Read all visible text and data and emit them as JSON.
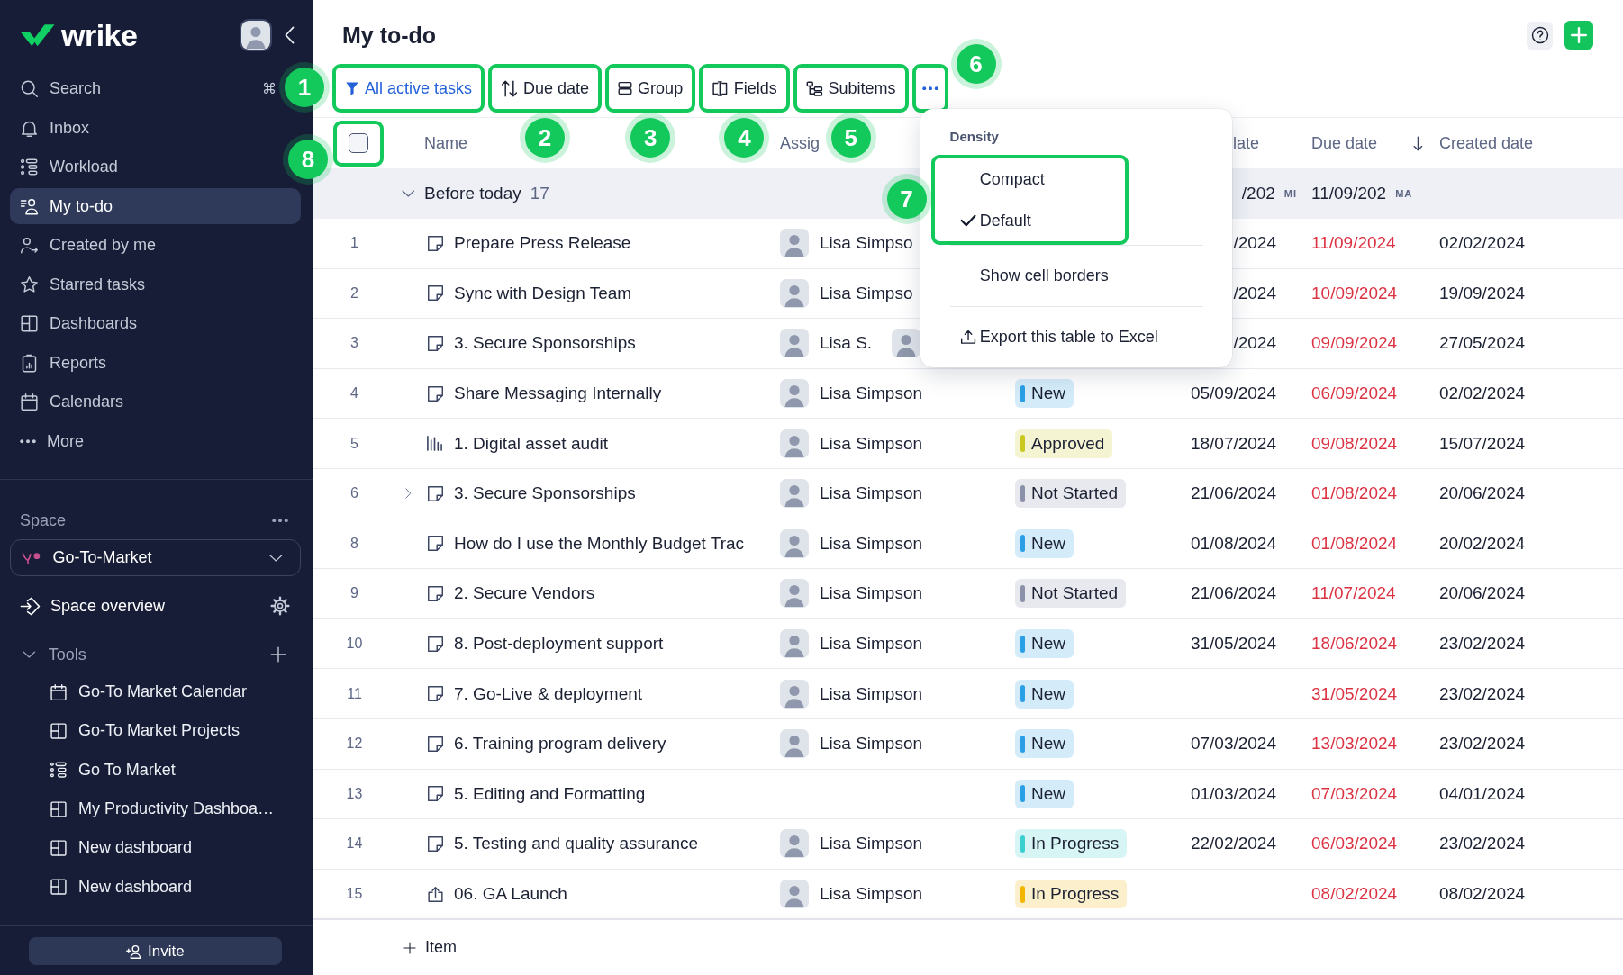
{
  "sidebar": {
    "logo": "wrike",
    "nav": [
      {
        "label": "Search",
        "shortcut": "⌘",
        "selected": false
      },
      {
        "label": "Inbox",
        "selected": false
      },
      {
        "label": "Workload",
        "selected": false
      },
      {
        "label": "My to-do",
        "selected": true
      },
      {
        "label": "Created by me",
        "selected": false
      },
      {
        "label": "Starred tasks",
        "selected": false
      },
      {
        "label": "Dashboards",
        "selected": false
      },
      {
        "label": "Reports",
        "selected": false
      },
      {
        "label": "Calendars",
        "selected": false
      },
      {
        "label": "More",
        "selected": false
      }
    ],
    "space": {
      "heading": "Space",
      "current": "Go-To-Market",
      "overview": "Space overview",
      "tools_label": "Tools",
      "tools_expanded": true,
      "tools": [
        {
          "label": "Go-To Market Calendar"
        },
        {
          "label": "Go-To Market Projects"
        },
        {
          "label": "Go To Market"
        },
        {
          "label": "My Productivity Dashboa…"
        },
        {
          "label": "New dashboard"
        },
        {
          "label": "New dashboard"
        }
      ]
    },
    "invite": "Invite"
  },
  "main": {
    "title": "My to-do",
    "toolbar": [
      {
        "label": "All active tasks",
        "active": true,
        "highlighted": true,
        "callout": "1"
      },
      {
        "label": "Due date",
        "active": false,
        "highlighted": true,
        "callout": "2"
      },
      {
        "label": "Group",
        "active": false,
        "highlighted": true,
        "callout": "3"
      },
      {
        "label": "Fields",
        "active": false,
        "highlighted": true,
        "callout": "4"
      },
      {
        "label": "Subitems",
        "active": false,
        "highlighted": true,
        "callout": "5"
      }
    ],
    "more": {
      "highlighted": true,
      "open": true,
      "callout": "6"
    },
    "menu": {
      "heading": "Density",
      "options_highlighted": true,
      "options_callout": "7",
      "options": [
        {
          "label": "Compact",
          "selected": false
        },
        {
          "label": "Default",
          "selected": true
        }
      ],
      "items": [
        {
          "kind": "toggle",
          "label": "Show cell borders",
          "checked": false
        },
        {
          "kind": "action",
          "label": "Export this table to Excel"
        }
      ]
    }
  },
  "table": {
    "select_all": {
      "checked": false,
      "highlighted": true,
      "callout": "8"
    },
    "columns": [
      {
        "kind": "name",
        "label": "Name",
        "sorted": false
      },
      {
        "kind": "assignee",
        "label": "Assig",
        "sorted": false
      },
      {
        "kind": "start",
        "label": "late",
        "sorted": false
      },
      {
        "kind": "due",
        "label": "Due date",
        "sorted": true
      },
      {
        "kind": "created",
        "label": "Created date",
        "sorted": false
      }
    ],
    "group": {
      "label": "Before today",
      "count": "17",
      "expanded": true,
      "start_summary": "/202",
      "start_tag": "MI",
      "due_summary": "11/09/202",
      "due_tag": "MA"
    },
    "rows": [
      {
        "number": "1",
        "kind": "task",
        "name": "Prepare Press Release",
        "has_children": false,
        "assignee": "Lisa Simpso",
        "extra_avatar": false,
        "start": "/2024",
        "due": "11/09/2024",
        "overdue": true,
        "created": "02/02/2024"
      },
      {
        "number": "2",
        "kind": "task",
        "name": "Sync with Design Team",
        "has_children": false,
        "assignee": "Lisa Simpso",
        "extra_avatar": false,
        "start": "/2024",
        "due": "10/09/2024",
        "overdue": true,
        "created": "19/09/2024"
      },
      {
        "number": "3",
        "kind": "task",
        "name": "3. Secure Sponsorships",
        "has_children": false,
        "assignee": "Lisa S.",
        "extra_avatar": true,
        "start": "/2024",
        "due": "09/09/2024",
        "overdue": true,
        "created": "27/05/2024"
      },
      {
        "number": "4",
        "kind": "task",
        "name": "Share Messaging Internally",
        "has_children": false,
        "assignee": "Lisa Simpson",
        "extra_avatar": false,
        "status": {
          "label": "New",
          "color": "#2a9fe6"
        },
        "start": "05/09/2024",
        "due": "06/09/2024",
        "overdue": true,
        "created": "02/02/2024"
      },
      {
        "number": "5",
        "kind": "chart",
        "name": "1. Digital asset audit",
        "has_children": false,
        "assignee": "Lisa Simpson",
        "extra_avatar": false,
        "status": {
          "label": "Approved",
          "color": "#c8c81e"
        },
        "start": "18/07/2024",
        "due": "09/08/2024",
        "overdue": true,
        "created": "15/07/2024"
      },
      {
        "number": "6",
        "kind": "task",
        "name": "3. Secure Sponsorships",
        "has_children": true,
        "assignee": "Lisa Simpson",
        "extra_avatar": false,
        "status": {
          "label": "Not Started",
          "color": "#8a91a8"
        },
        "start": "21/06/2024",
        "due": "01/08/2024",
        "overdue": true,
        "created": "20/06/2024"
      },
      {
        "number": "8",
        "kind": "task",
        "name": "How do I use the Monthly Budget Trac",
        "has_children": false,
        "assignee": "Lisa Simpson",
        "extra_avatar": false,
        "status": {
          "label": "New",
          "color": "#2a9fe6"
        },
        "start": "01/08/2024",
        "due": "01/08/2024",
        "overdue": true,
        "created": "20/02/2024"
      },
      {
        "number": "9",
        "kind": "task",
        "name": "2. Secure Vendors",
        "has_children": false,
        "assignee": "Lisa Simpson",
        "extra_avatar": false,
        "status": {
          "label": "Not Started",
          "color": "#8a91a8"
        },
        "start": "21/06/2024",
        "due": "11/07/2024",
        "overdue": true,
        "created": "20/06/2024"
      },
      {
        "number": "10",
        "kind": "task",
        "name": "8. Post-deployment support",
        "has_children": false,
        "assignee": "Lisa Simpson",
        "extra_avatar": false,
        "status": {
          "label": "New",
          "color": "#2a9fe6"
        },
        "start": "31/05/2024",
        "due": "18/06/2024",
        "overdue": true,
        "created": "23/02/2024"
      },
      {
        "number": "11",
        "kind": "task",
        "name": "7. Go-Live & deployment",
        "has_children": false,
        "assignee": "Lisa Simpson",
        "extra_avatar": false,
        "status": {
          "label": "New",
          "color": "#2a9fe6"
        },
        "due": "31/05/2024",
        "overdue": true,
        "created": "23/02/2024"
      },
      {
        "number": "12",
        "kind": "task",
        "name": "6. Training program delivery",
        "has_children": false,
        "assignee": "Lisa Simpson",
        "extra_avatar": false,
        "status": {
          "label": "New",
          "color": "#2a9fe6"
        },
        "start": "07/03/2024",
        "due": "13/03/2024",
        "overdue": true,
        "created": "23/02/2024"
      },
      {
        "number": "13",
        "kind": "task",
        "name": "5. Editing and Formatting",
        "has_children": false,
        "extra_avatar": false,
        "status": {
          "label": "New",
          "color": "#2a9fe6"
        },
        "start": "01/03/2024",
        "due": "07/03/2024",
        "overdue": true,
        "created": "04/01/2024"
      },
      {
        "number": "14",
        "kind": "task",
        "name": "5. Testing and quality assurance",
        "has_children": false,
        "assignee": "Lisa Simpson",
        "extra_avatar": false,
        "status": {
          "label": "In Progress",
          "color": "#3ccfd0"
        },
        "start": "22/02/2024",
        "due": "06/03/2024",
        "overdue": true,
        "created": "23/02/2024"
      },
      {
        "number": "15",
        "kind": "upload",
        "name": "06. GA Launch",
        "has_children": false,
        "assignee": "Lisa Simpson",
        "extra_avatar": false,
        "status": {
          "label": "In Progress",
          "color": "#f2b600"
        },
        "due": "08/02/2024",
        "overdue": true,
        "created": "08/02/2024"
      }
    ],
    "add_item": "Item"
  }
}
